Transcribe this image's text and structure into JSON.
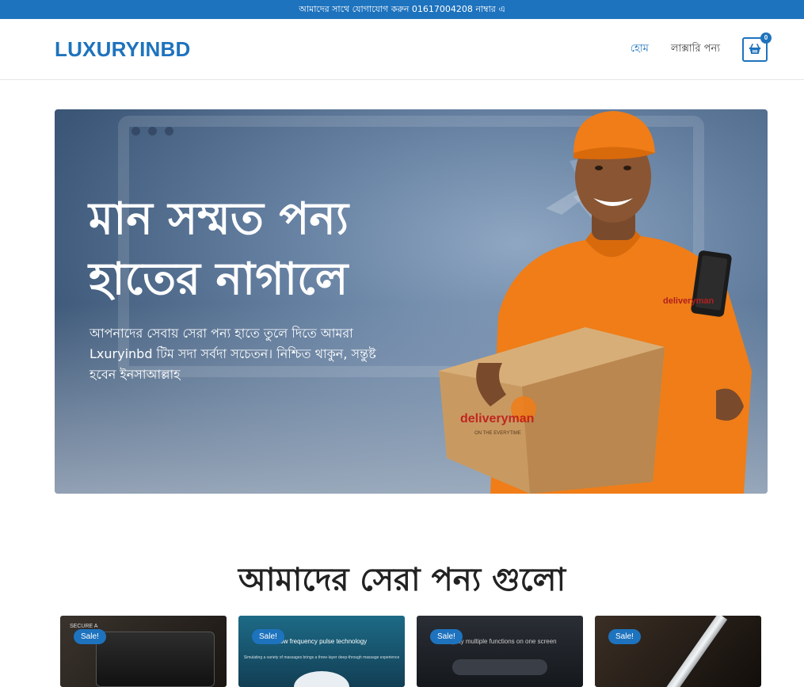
{
  "topbar": {
    "text": "আমাদের সাথে যোগাযোগ করুন 01617004208 নাম্বার এ"
  },
  "header": {
    "logo": "LUXURYINBD",
    "nav": [
      {
        "label": "হোম",
        "active": true
      },
      {
        "label": "লাক্সারি পন্য",
        "active": false
      }
    ],
    "cart_count": "0",
    "cart_icon": "shopping-basket-icon"
  },
  "hero": {
    "title_line1": "মান সম্মত পন্য",
    "title_line2": "হাতের নাগালে",
    "text": "আপনাদের সেবায় সেরা পন্য হাতে তুলে দিতে আমরা Lxuryinbd টিম সদা সর্বদা সচেতন। নিশ্চিত থাকুন, সন্তুষ্ট হবেন ইনসাআল্লাহ",
    "brand_mark": "deliveryman",
    "brand_tagline": "ON THE EVERYTIME"
  },
  "section": {
    "title": "আমাদের সেরা পন্য গুলো"
  },
  "products": [
    {
      "badge": "Sale!",
      "caption": "",
      "sub": "",
      "corner": "SECURE A",
      "bg": "#2a2623"
    },
    {
      "badge": "Sale!",
      "caption": "Low frequency pulse technology",
      "sub": "Simulating a variety of massages brings a three-layer deep-through massage experience",
      "corner": "",
      "bg": "#1f5e78"
    },
    {
      "badge": "Sale!",
      "caption": "Display multiple functions on one screen",
      "sub": "",
      "corner": "",
      "bg": "#1c1f24"
    },
    {
      "badge": "Sale!",
      "caption": "",
      "sub": "",
      "corner": "",
      "bg": "#2b2420"
    }
  ],
  "colors": {
    "primary": "#1e73be",
    "sale_badge": "#1e73be",
    "shirt": "#f07d17"
  }
}
